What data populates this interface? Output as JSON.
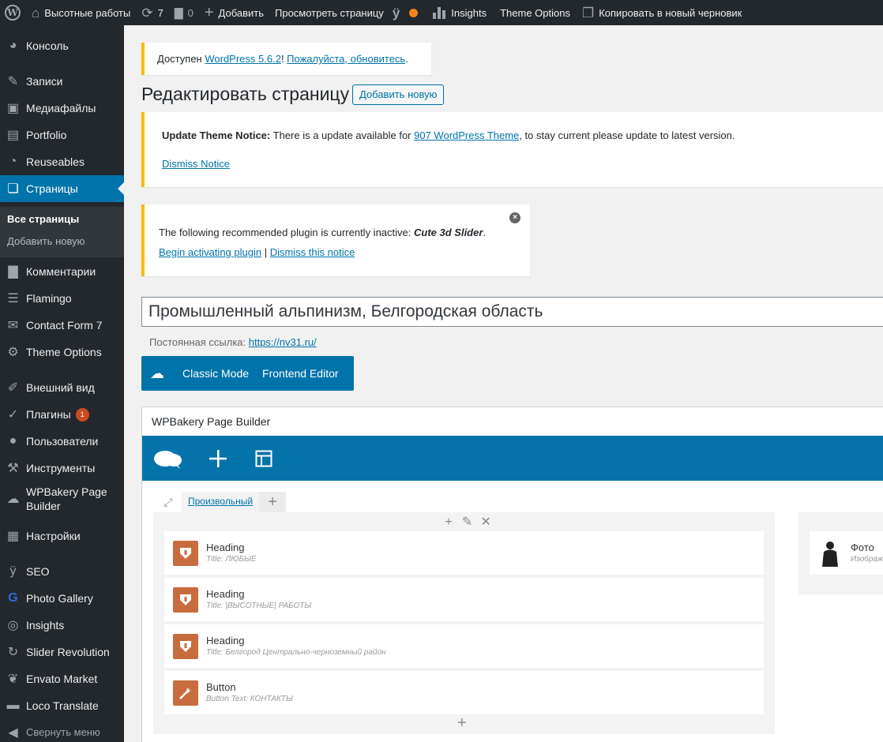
{
  "admin_bar": {
    "site_name": "Высотные работы",
    "updates_count": "7",
    "comments_count": "0",
    "add_label": "Добавить",
    "view_page_label": "Просмотреть страницу",
    "insights_label": "Insights",
    "theme_options_label": "Theme Options",
    "copy_draft_label": "Копировать в новый черновик",
    "seo_status_color": "#f6821f"
  },
  "sidebar": {
    "items": [
      {
        "label": "Консоль",
        "icon": "dashboard-icon"
      },
      {
        "label": "Записи",
        "icon": "pin-icon"
      },
      {
        "label": "Медиафайлы",
        "icon": "media-icon"
      },
      {
        "label": "Portfolio",
        "icon": "portfolio-icon"
      },
      {
        "label": "Reuseables",
        "icon": "pie-icon"
      },
      {
        "label": "Страницы",
        "icon": "pages-icon"
      },
      {
        "label": "Комментарии",
        "icon": "comment-icon"
      },
      {
        "label": "Flamingo",
        "icon": "flamingo-icon"
      },
      {
        "label": "Contact Form 7",
        "icon": "mail-icon"
      },
      {
        "label": "Theme Options",
        "icon": "gear-icon"
      },
      {
        "label": "Внешний вид",
        "icon": "brush-icon"
      },
      {
        "label": "Плагины",
        "icon": "plugin-icon",
        "badge": "1"
      },
      {
        "label": "Пользователи",
        "icon": "user-icon"
      },
      {
        "label": "Инструменты",
        "icon": "wrench-icon"
      },
      {
        "label": "WPBakery Page Builder",
        "icon": "wpbakery-icon"
      },
      {
        "label": "Настройки",
        "icon": "settings-icon"
      },
      {
        "label": "SEO",
        "icon": "yoast-icon"
      },
      {
        "label": "Photo Gallery",
        "icon": "gallery-icon"
      },
      {
        "label": "Insights",
        "icon": "insights-icon"
      },
      {
        "label": "Slider Revolution",
        "icon": "refresh-icon"
      },
      {
        "label": "Envato Market",
        "icon": "leaf-icon"
      },
      {
        "label": "Loco Translate",
        "icon": "translate-icon"
      },
      {
        "label": "Свернуть меню",
        "icon": "collapse-icon"
      }
    ],
    "submenu": [
      "Все страницы",
      "Добавить новую"
    ]
  },
  "update_notice": {
    "prefix": "Доступен ",
    "version_link": "WordPress 5.6.2",
    "separator": "! ",
    "update_link": "Пожалуйста, обновитесь",
    "suffix": "."
  },
  "page_title": "Редактировать страницу",
  "add_new_button": "Добавить новую",
  "theme_notice": {
    "bold": "Update Theme Notice:",
    "text": " There is a update available for ",
    "theme_link": "907 WordPress Theme",
    "suffix": ", to stay current please update to latest version.",
    "dismiss": "Dismiss Notice"
  },
  "plugin_notice": {
    "text": "The following recommended plugin is currently inactive: ",
    "plugin_name": "Cute 3d Slider",
    "suffix": ".",
    "activate_link": "Begin activating plugin",
    "separator": " | ",
    "dismiss_link": "Dismiss this notice"
  },
  "post_title": "Промышленный альпинизм, Белгородская область",
  "permalink": {
    "label": "Постоянная ссылка: ",
    "url": "https://nv31.ru/"
  },
  "editor_switch": {
    "classic": "Classic Mode",
    "frontend": "Frontend Editor"
  },
  "wpbakery": {
    "title": "WPBakery Page Builder",
    "tab_label": "Произвольный",
    "elements": [
      {
        "name": "Heading",
        "sub": "Title: ЛЮБЫЕ",
        "icon": "heading-icon"
      },
      {
        "name": "Heading",
        "sub": "Title: |ВЫСОТНЫЕ| РАБОТЫ",
        "icon": "heading-icon"
      },
      {
        "name": "Heading",
        "sub": "Title: Белгород Центрально-черноземный район",
        "icon": "heading-icon"
      },
      {
        "name": "Button",
        "sub": "Button Text: КОНТАКТЫ",
        "icon": "button-icon"
      }
    ],
    "right_element": {
      "name": "Фото",
      "sub": "Изображ"
    },
    "accent": "#0473aa",
    "element_icon_color": "#c86b3f"
  }
}
